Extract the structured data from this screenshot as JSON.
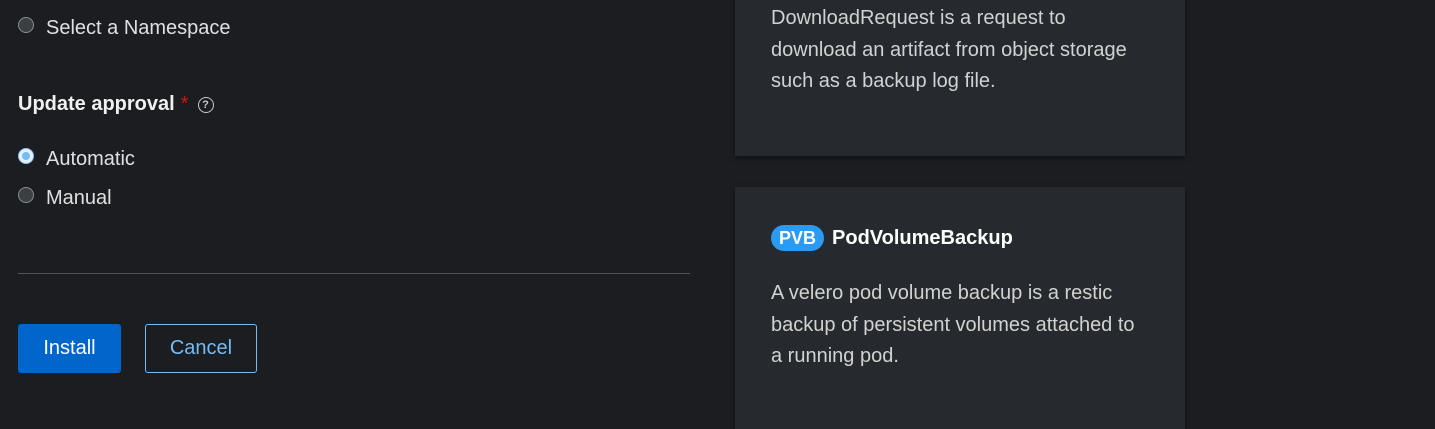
{
  "namespace_option": {
    "label": "Select a Namespace"
  },
  "update_approval": {
    "label": "Update approval",
    "required_mark": "*",
    "help_glyph": "?",
    "options": [
      {
        "label": "Automatic",
        "checked": true
      },
      {
        "label": "Manual",
        "checked": false
      }
    ]
  },
  "actions": {
    "install_label": "Install",
    "cancel_label": "Cancel"
  },
  "cards": [
    {
      "description": "DownloadRequest is a request to download an artifact from object storage such as a backup log file."
    },
    {
      "badge": "PVB",
      "name": "PodVolumeBackup",
      "description": "A velero pod volume backup is a restic backup of persistent volumes attached to a running pod."
    }
  ],
  "colors": {
    "background": "#1b1d21",
    "card": "#26292d",
    "primary": "#0066cc",
    "link": "#73bcf7",
    "required": "#c9190b",
    "badge": "#2b9af3"
  }
}
